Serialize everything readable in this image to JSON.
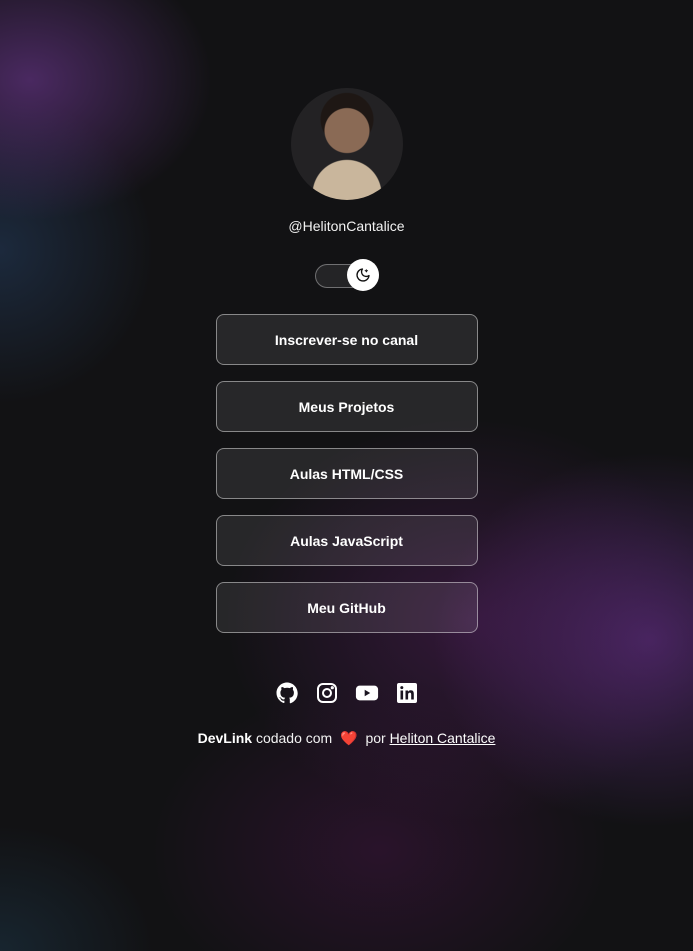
{
  "profile": {
    "username": "@HelitonCantalice",
    "avatar_alt": "avatar"
  },
  "theme_switch": {
    "state": "dark",
    "icon": "moon-icon"
  },
  "links": [
    {
      "label": "Inscrever-se no canal"
    },
    {
      "label": "Meus Projetos"
    },
    {
      "label": "Aulas HTML/CSS"
    },
    {
      "label": "Aulas JavaScript"
    },
    {
      "label": "Meu GitHub"
    }
  ],
  "social": [
    {
      "icon": "github-icon"
    },
    {
      "icon": "instagram-icon"
    },
    {
      "icon": "youtube-icon"
    },
    {
      "icon": "linkedin-icon"
    }
  ],
  "footer": {
    "brand": "DevLink",
    "text_before_heart": "codado com",
    "heart": "❤️",
    "text_after_heart": "por",
    "author_link": "Heliton Cantalice"
  },
  "colors": {
    "background": "#121214",
    "accent_purple": "#6e3296",
    "heart": "#e11d2c"
  }
}
